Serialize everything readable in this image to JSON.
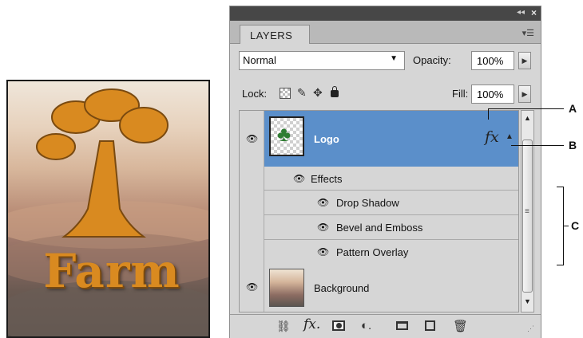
{
  "artwork": {
    "title": "Farm"
  },
  "panel": {
    "tab_label": "LAYERS",
    "blend_mode": "Normal",
    "opacity_label": "Opacity:",
    "opacity_value": "100%",
    "lock_label": "Lock:",
    "fill_label": "Fill:",
    "fill_value": "100%",
    "layers": {
      "logo": {
        "name": "Logo"
      },
      "effects_label": "Effects",
      "effects": [
        "Drop Shadow",
        "Bevel and Emboss",
        "Pattern Overlay"
      ],
      "background": {
        "name": "Background"
      }
    }
  },
  "callouts": {
    "a": "A",
    "b": "B",
    "c": "C"
  },
  "colors": {
    "selected_layer": "#5b8fca",
    "panel_bg": "#d6d6d6",
    "farm_text": "#d98a20"
  }
}
